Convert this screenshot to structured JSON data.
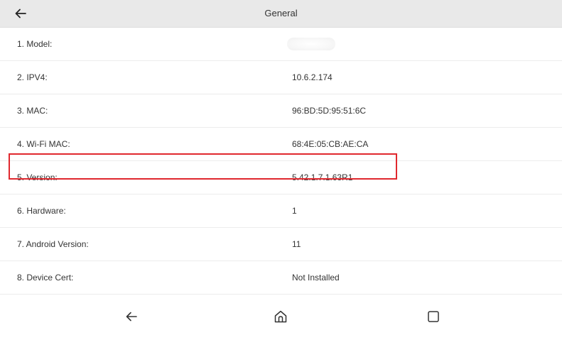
{
  "header": {
    "title": "General",
    "back_icon": "arrow-left-icon"
  },
  "rows": [
    {
      "label": "1. Model:",
      "value": "",
      "redacted": true
    },
    {
      "label": "2. IPV4:",
      "value": "10.6.2.174"
    },
    {
      "label": "3. MAC:",
      "value": "96:BD:5D:95:51:6C"
    },
    {
      "label": "4. Wi-Fi MAC:",
      "value": "68:4E:05:CB:AE:CA"
    },
    {
      "label": "5. Version:",
      "value": "5.42.1.7.1.63R1",
      "highlighted": true
    },
    {
      "label": "6. Hardware:",
      "value": "1"
    },
    {
      "label": "7. Android Version:",
      "value": "11"
    },
    {
      "label": "8. Device Cert:",
      "value": "Not Installed"
    }
  ],
  "navbar": {
    "back_icon": "nav-back-icon",
    "home_icon": "home-icon",
    "recents_icon": "recents-square-icon"
  },
  "colors": {
    "title_bar_bg": "#e9e9e9",
    "highlight_border": "#e0282e",
    "text": "#333333"
  }
}
